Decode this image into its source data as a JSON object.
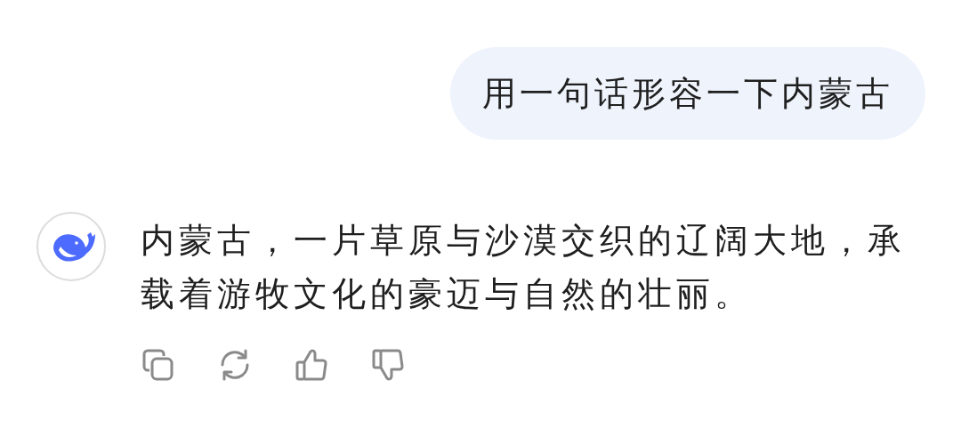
{
  "messages": [
    {
      "kind": "user",
      "text": "用一句话形容一下内蒙古"
    },
    {
      "kind": "assistant",
      "text": "内蒙古，一片草原与沙漠交织的辽阔大地，承载着游牧文化的豪迈与自然的壮丽。",
      "actions": [
        {
          "kind": "copy"
        },
        {
          "kind": "regenerate"
        },
        {
          "kind": "like"
        },
        {
          "kind": "dislike"
        }
      ]
    }
  ]
}
